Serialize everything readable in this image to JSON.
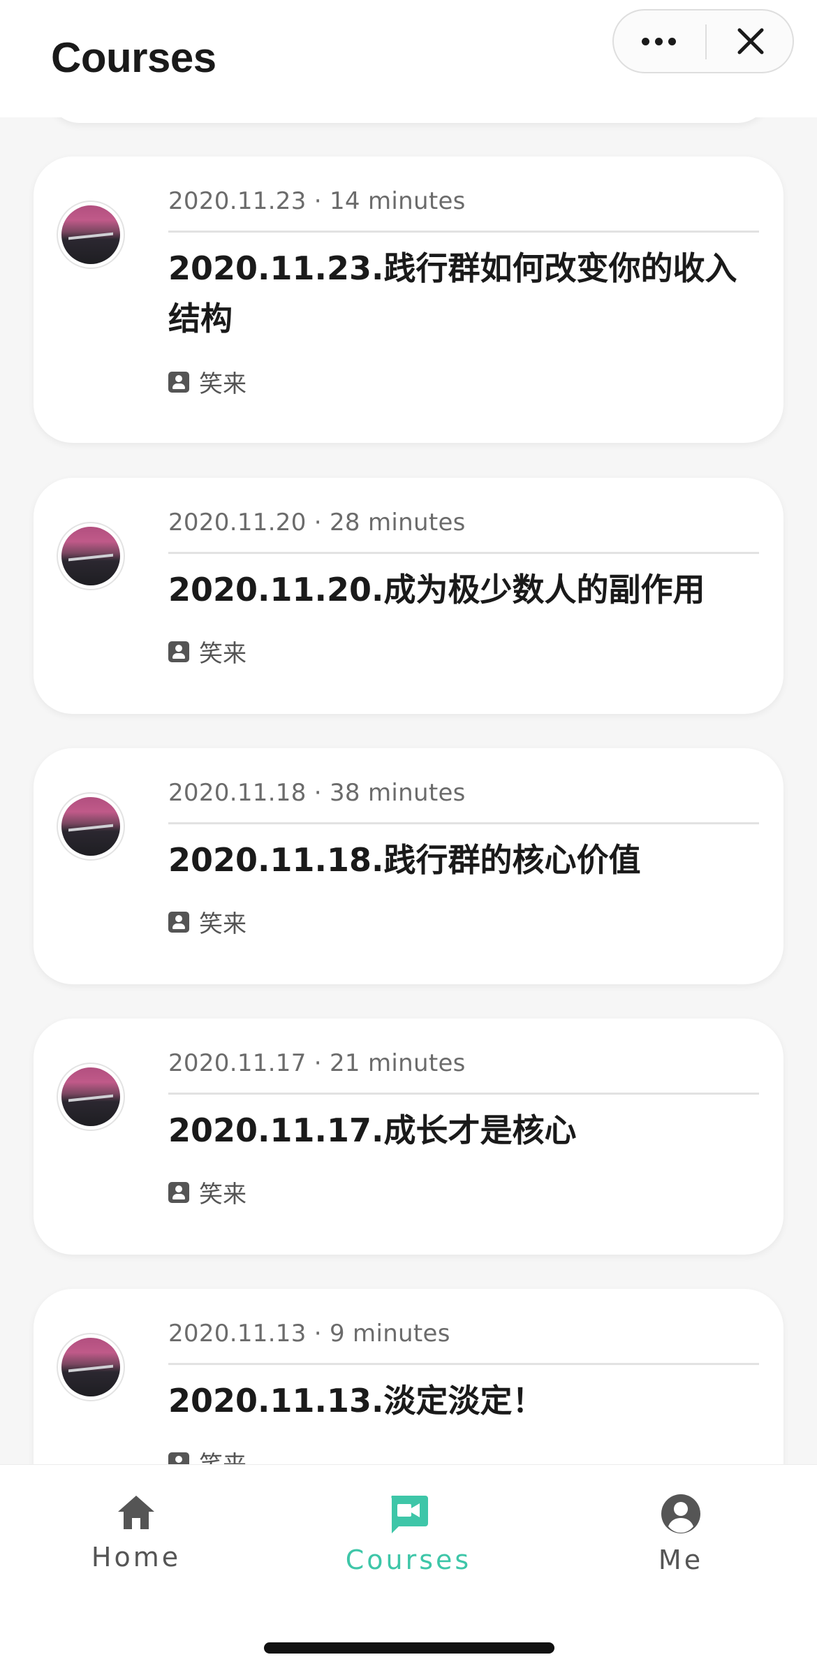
{
  "header": {
    "title": "Courses",
    "more_icon": "more-dots-icon",
    "close_icon": "close-icon"
  },
  "courses": [
    {
      "meta": "2020.11.23 · 14 minutes",
      "title": "2020.11.23.践行群如何改变你的收入结构",
      "author": "笑来"
    },
    {
      "meta": "2020.11.20 · 28 minutes",
      "title": "2020.11.20.成为极少数人的副作用",
      "author": "笑来"
    },
    {
      "meta": "2020.11.18 · 38 minutes",
      "title": "2020.11.18.践行群的核心价值",
      "author": "笑来"
    },
    {
      "meta": "2020.11.17 · 21 minutes",
      "title": "2020.11.17.成长才是核心",
      "author": "笑来"
    },
    {
      "meta": "2020.11.13 · 9 minutes",
      "title": "2020.11.13.淡定淡定！",
      "author": "笑来"
    }
  ],
  "tabbar": {
    "home": "Home",
    "courses": "Courses",
    "me": "Me",
    "active": "courses",
    "accent_color": "#3ec6a8",
    "inactive_color": "#555555"
  }
}
